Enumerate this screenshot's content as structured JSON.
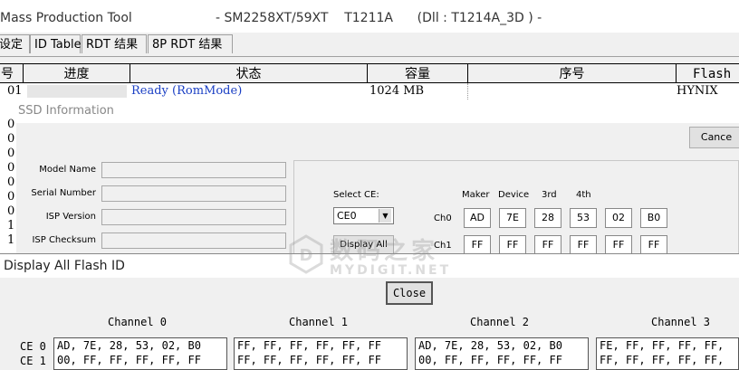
{
  "main_window": {
    "title_left": "Mass Production Tool",
    "title_right": "- SM2258XT/59XT    T1211A      (Dll : T1214A_3D ) -",
    "tabs": [
      "设定",
      "ID Table",
      "RDT 结果",
      "8P RDT 结果"
    ],
    "grid": {
      "headers": [
        "号",
        "进度",
        "状态",
        "容量",
        "序号",
        "Flash"
      ],
      "row": {
        "num": "01",
        "status": "Ready (RomMode)",
        "capacity": "1024 MB",
        "flash": "HYNIX"
      },
      "left_digits": [
        "0",
        "0",
        "0",
        "0",
        "0",
        "0",
        "0",
        "1",
        "1"
      ]
    }
  },
  "ssd_info": {
    "title": "SSD Information",
    "cancel_label": "Cance",
    "fields": [
      {
        "label": "Model Name",
        "value": ""
      },
      {
        "label": "Serial Number",
        "value": ""
      },
      {
        "label": "ISP Version",
        "value": ""
      },
      {
        "label": "ISP Checksum",
        "value": ""
      }
    ],
    "select_ce_label": "Select CE:",
    "select_ce_value": "CE0",
    "display_all_label": "Display All",
    "id_headers": [
      "Maker",
      "Device",
      "3rd",
      "4th"
    ],
    "ch0_label": "Ch0",
    "ch0_values": [
      "AD",
      "7E",
      "28",
      "53",
      "02",
      "B0"
    ],
    "ch1_label": "Ch1",
    "ch1_values": [
      "FF",
      "FF",
      "FF",
      "FF",
      "FF",
      "FF"
    ]
  },
  "flash_id": {
    "title": "Display All Flash ID",
    "close_label": "Close",
    "channels": [
      {
        "label": "Channel 0",
        "ce0": "AD, 7E, 28, 53, 02, B0",
        "ce1": "00, FF, FF, FF, FF, FF"
      },
      {
        "label": "Channel 1",
        "ce0": "FF, FF, FF, FF, FF, FF",
        "ce1": "FF, FF, FF, FF, FF, FF"
      },
      {
        "label": "Channel 2",
        "ce0": "AD, 7E, 28, 53, 02, B0",
        "ce1": "00, FF, FF, FF, FF, FF"
      },
      {
        "label": "Channel 3",
        "ce0": "FE, FF, FF, FF, FF,",
        "ce1": "FF, FF, FF, FF, FF,"
      }
    ],
    "ce_labels": [
      "CE 0",
      "CE 1"
    ]
  },
  "watermark": {
    "cn": "数码之家",
    "en": "MYDIGIT.NET"
  }
}
